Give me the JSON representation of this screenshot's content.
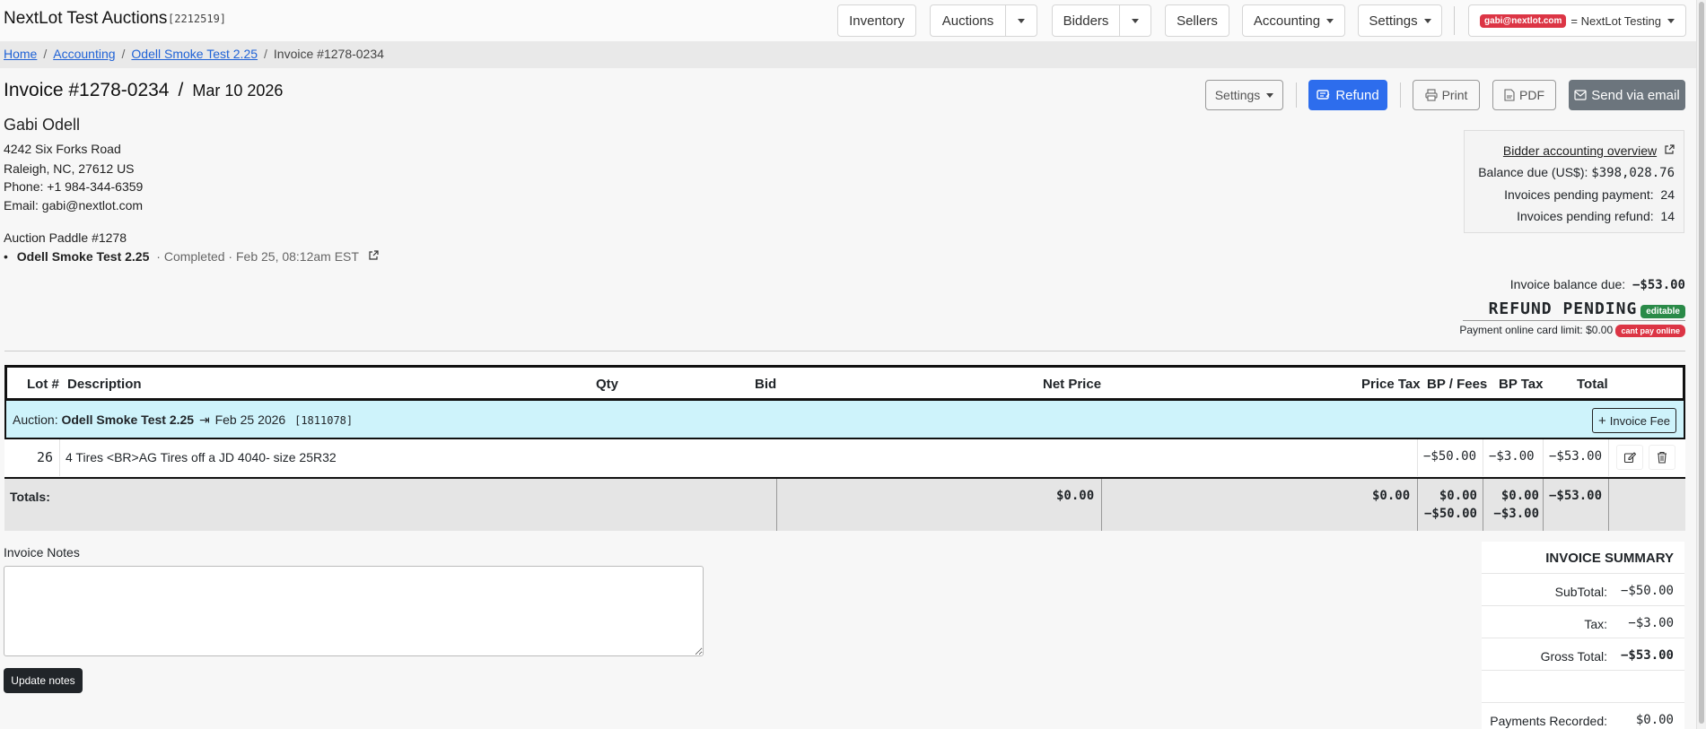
{
  "app": {
    "title": "NextLot Test Auctions",
    "id": "[2212519]"
  },
  "nav": {
    "inventory": "Inventory",
    "auctions": "Auctions",
    "bidders": "Bidders",
    "sellers": "Sellers",
    "accounting": "Accounting",
    "settings": "Settings",
    "user_email": "gabi@nextlot.com",
    "user_account": "= NextLot Testing"
  },
  "breadcrumb": [
    "Home",
    "Accounting",
    "Odell Smoke Test 2.25",
    "Invoice #1278-0234"
  ],
  "invoice": {
    "number": "Invoice #1278-0234",
    "date": "Mar 10 2026"
  },
  "actions": {
    "settings": "Settings",
    "refund": "Refund",
    "print": "Print",
    "pdf": "PDF",
    "email": "Send via email"
  },
  "customer": {
    "name": "Gabi Odell",
    "address1": "4242 Six Forks Road",
    "address2": "Raleigh, NC, 27612 US",
    "phone": "Phone: +1 984-344-6359",
    "email": "Email: gabi@nextlot.com",
    "paddle": "Auction Paddle #1278",
    "auction_name": "Odell Smoke Test 2.25",
    "auction_status": "· Completed · Feb 25, 08:12am EST"
  },
  "balance_box": {
    "link": "Bidder accounting overview",
    "balance_label": "Balance due (US$):",
    "balance_value": "$398,028.76",
    "pending_payment_label": "Invoices pending payment:",
    "pending_payment_value": "24",
    "pending_refund_label": "Invoices pending refund:",
    "pending_refund_value": "14"
  },
  "status": {
    "balance_label": "Invoice balance due:",
    "balance_value": "−$53.00",
    "state": "REFUND PENDING",
    "state_badge": "editable",
    "card_limit": "Payment online card limit: $0.00",
    "card_badge": "cant pay online"
  },
  "table": {
    "headers": {
      "lot": "Lot #",
      "description": "Description",
      "qty": "Qty",
      "bid": "Bid",
      "net": "Net Price",
      "price_tax": "Price Tax",
      "bp_fees": "BP / Fees",
      "bp_tax": "BP Tax",
      "total": "Total"
    },
    "auction_row": {
      "prefix": "Auction:",
      "name": "Odell Smoke Test 2.25",
      "date": "Feb 25 2026",
      "id": "[1811078]",
      "fee_button": "Invoice Fee"
    },
    "rows": [
      {
        "lot": "26",
        "description": "4 Tires <BR>AG Tires off a JD 4040- size 25R32",
        "bp_fees": "−$50.00",
        "bp_tax": "−$3.00",
        "total": "−$53.00"
      }
    ],
    "totals": {
      "label": "Totals:",
      "net": "$0.00",
      "price_tax": "$0.00",
      "bp_fees_1": "$0.00",
      "bp_fees_2": "−$50.00",
      "bp_tax_1": "$0.00",
      "bp_tax_2": "−$3.00",
      "total": "−$53.00"
    }
  },
  "notes": {
    "label": "Invoice Notes",
    "value": "",
    "button": "Update notes"
  },
  "summary": {
    "title": "INVOICE SUMMARY",
    "subtotal_label": "SubTotal:",
    "subtotal": "−$50.00",
    "tax_label": "Tax:",
    "tax": "−$3.00",
    "gross_label": "Gross Total:",
    "gross": "−$53.00",
    "payments_label": "Payments Recorded:",
    "payments": "$0.00"
  }
}
